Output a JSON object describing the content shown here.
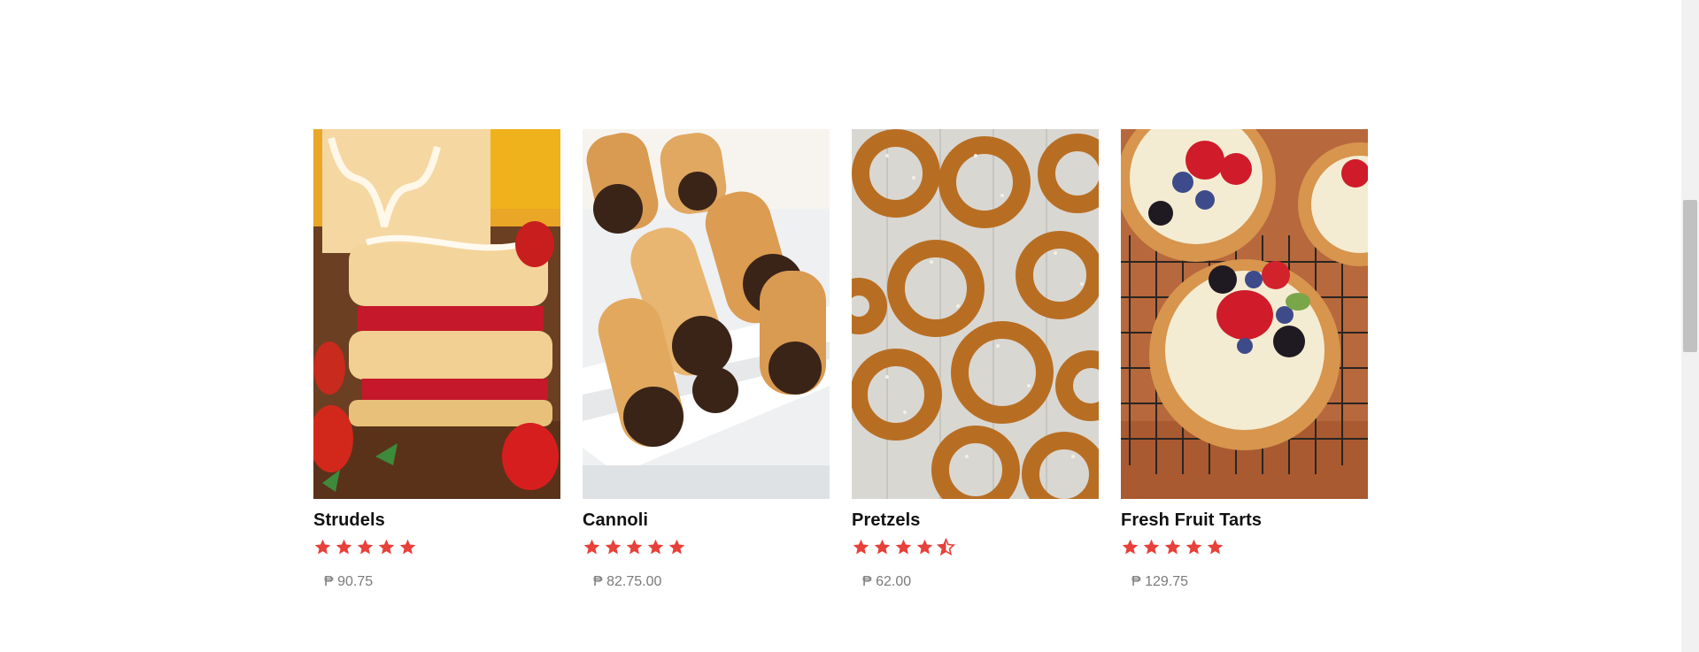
{
  "products": [
    {
      "name": "Strudels",
      "rating": 5,
      "price": "₱ 90.75",
      "image": "strudel-photo"
    },
    {
      "name": "Cannoli",
      "rating": 5,
      "price": "₱ 82.75.00",
      "image": "cannoli-photo"
    },
    {
      "name": "Pretzels",
      "rating": 4.5,
      "price": "₱ 62.00",
      "image": "pretzel-photo"
    },
    {
      "name": "Fresh Fruit Tarts",
      "rating": 5,
      "price": "₱ 129.75",
      "image": "fruit-tart-photo"
    }
  ],
  "colors": {
    "star": "#e8403a",
    "name": "#111111",
    "price": "#7a7a7a"
  }
}
